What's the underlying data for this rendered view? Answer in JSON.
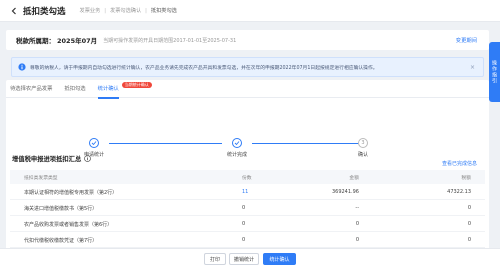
{
  "header": {
    "title": "抵扣类勾选",
    "breadcrumb": [
      "发票业务",
      "发票勾选确认",
      "抵扣类勾选"
    ]
  },
  "period": {
    "label": "税款所属期：",
    "value": "2025年07月",
    "note": "当期可操作发票的开具日期范围2017-01-01至2025-07-31",
    "link": "变更期间"
  },
  "notice": {
    "text": "尊敬的纳税人，请于申报期内自动勾选进行统计确认，农产品业务请先完成农产品开具和发票勾选，并在次年的申报期2022年07月1日起按规定进行相应确认操作。"
  },
  "tabs": [
    {
      "label": "待选择农产品发票",
      "active": false
    },
    {
      "label": "抵扣勾选",
      "active": false
    },
    {
      "label": "统计确认",
      "active": true,
      "badge": "当期统计确认"
    }
  ],
  "steps": [
    {
      "label": "申请统计",
      "state": "done"
    },
    {
      "label": "统计完成",
      "state": "done"
    },
    {
      "label": "确认",
      "state": "pending",
      "number": "3"
    }
  ],
  "view_link": "查看已完成信息",
  "section": {
    "title": "增值税申报进项抵扣汇总"
  },
  "table": {
    "columns": [
      "抵扣类发票类型",
      "份数",
      "金额",
      "税额"
    ],
    "rows": [
      {
        "name": "本期认证相符的增值税专用发票（第2行）",
        "count": "11",
        "amount": "369241.96",
        "tax": "47322.13",
        "count_link": true
      },
      {
        "name": "海关进口增值税缴款书（第5行）",
        "count": "0",
        "amount": "--",
        "tax": "0",
        "count_link": false
      },
      {
        "name": "农产品收购发票或者销售发票（第6行）",
        "count": "0",
        "amount": "0",
        "tax": "0",
        "count_link": false
      },
      {
        "name": "代扣代缴税收缴款凭证（第7行）",
        "count": "0",
        "amount": "0",
        "tax": "0",
        "count_link": false
      }
    ]
  },
  "footer": {
    "print": "打印",
    "revoke": "撤销统计",
    "confirm": "统计确认"
  },
  "float_tab": "操作指引",
  "colors": {
    "primary": "#2f7cf6",
    "badge": "#f0473a"
  }
}
